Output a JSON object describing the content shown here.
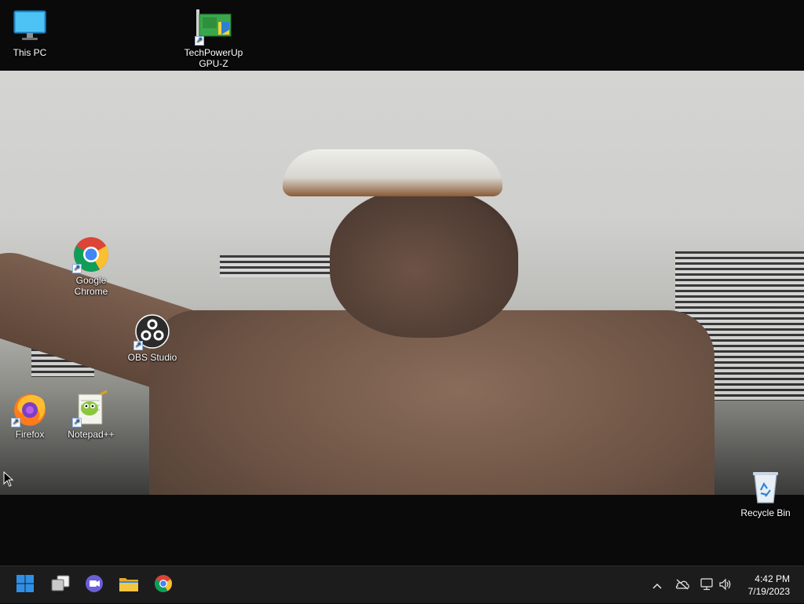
{
  "desktop": {
    "icons": [
      {
        "label": "This PC",
        "icon": "monitor-icon"
      },
      {
        "label": "TechPowerUp GPU-Z",
        "icon": "gpuz-icon"
      },
      {
        "label": "Google Chrome",
        "icon": "chrome-icon"
      },
      {
        "label": "OBS Studio",
        "icon": "obs-icon"
      },
      {
        "label": "Firefox",
        "icon": "firefox-icon"
      },
      {
        "label": "Notepad++",
        "icon": "notepadpp-icon"
      },
      {
        "label": "Recycle Bin",
        "icon": "recycle-bin-icon"
      }
    ]
  },
  "taskbar": {
    "apps": [
      {
        "name": "Start",
        "icon": "windows-start-icon"
      },
      {
        "name": "Task View",
        "icon": "task-view-icon"
      },
      {
        "name": "Chat",
        "icon": "chat-icon"
      },
      {
        "name": "File Explorer",
        "icon": "folder-icon"
      },
      {
        "name": "Google Chrome",
        "icon": "chrome-icon"
      }
    ],
    "tray": {
      "chevron": "^",
      "time": "4:42 PM",
      "date": "7/19/2023"
    }
  },
  "colors": {
    "taskbar_bg": "#1c1c1c",
    "start_blue": "#2f8fe6",
    "folder_yellow": "#f5c542"
  }
}
